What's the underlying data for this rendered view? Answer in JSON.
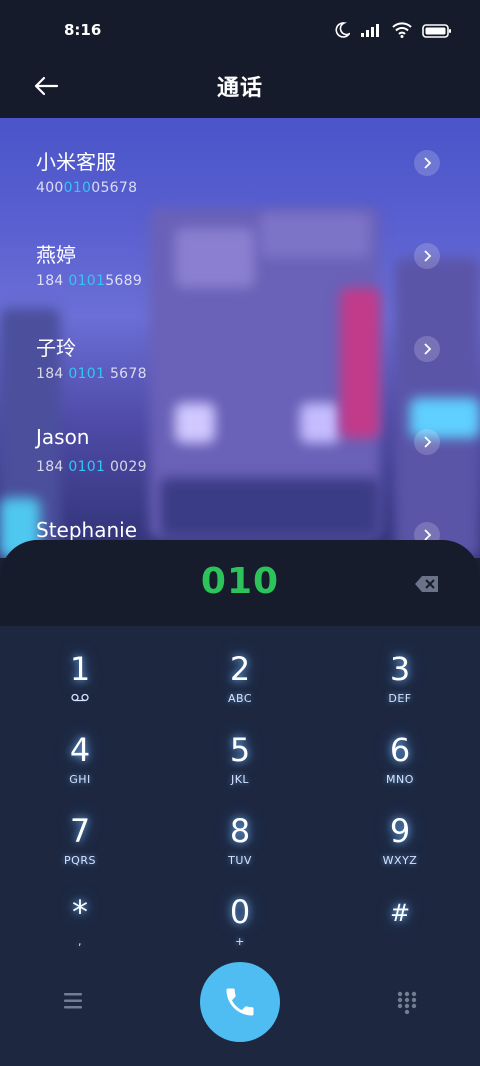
{
  "status_bar": {
    "time": "8:16"
  },
  "header": {
    "title": "通话"
  },
  "contacts": [
    {
      "name": "小米客服",
      "number_pre": "400",
      "number_hl": "010",
      "number_post": "05678"
    },
    {
      "name": "燕婷",
      "number_pre": "184 ",
      "number_hl": "0101",
      "number_post": "5689"
    },
    {
      "name": "子玲",
      "number_pre": "184 ",
      "number_hl": "0101",
      "number_post": " 5678"
    },
    {
      "name": "Jason",
      "number_pre": "184 ",
      "number_hl": "0101",
      "number_post": " 0029"
    },
    {
      "name": "Stephanie",
      "number_pre": "",
      "number_hl": "",
      "number_post": ""
    }
  ],
  "dialer": {
    "entered": "010",
    "keys": [
      {
        "digit": "1",
        "letters": "",
        "icon": "voicemail-icon"
      },
      {
        "digit": "2",
        "letters": "ABC"
      },
      {
        "digit": "3",
        "letters": "DEF"
      },
      {
        "digit": "4",
        "letters": "GHI"
      },
      {
        "digit": "5",
        "letters": "JKL"
      },
      {
        "digit": "6",
        "letters": "MNO"
      },
      {
        "digit": "7",
        "letters": "PQRS"
      },
      {
        "digit": "8",
        "letters": "TUV"
      },
      {
        "digit": "9",
        "letters": "WXYZ"
      },
      {
        "digit": "*",
        "letters": ","
      },
      {
        "digit": "0",
        "letters": "+"
      },
      {
        "digit": "#",
        "letters": ""
      }
    ]
  },
  "colors": {
    "accent": "#33c6f5",
    "call": "#4fbdf1",
    "entered_digits": "#2bc35a"
  },
  "icons": {
    "back": "arrow-left-icon",
    "delete": "backspace-icon",
    "menu": "menu-icon",
    "call": "phone-icon",
    "dialpad": "dialpad-icon"
  }
}
